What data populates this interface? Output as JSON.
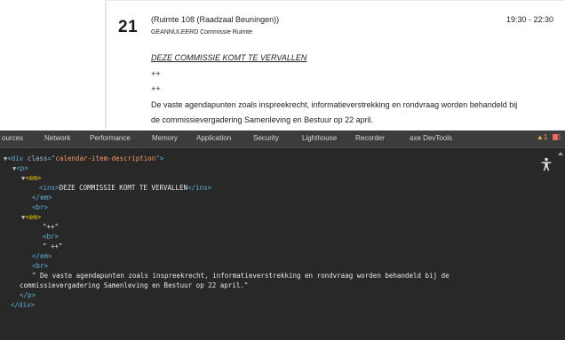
{
  "page": {
    "day": "21",
    "location": "(Ruimte 108 (Raadzaal Beuningen))",
    "status": "GEANNULEERD Commissie Ruimte",
    "time": "19:30 - 22:30",
    "cancel_notice": "DEZE COMMISSIE KOMT TE VERVALLEN",
    "plus1": "++",
    "plus2": "++",
    "body_line1": "De vaste agendapunten zoals inspreekrecht, informatieverstrekking en rondvraag worden behandeld bij",
    "body_line2": "de commissievergadering Samenleving en Bestuur op 22 april."
  },
  "devtools": {
    "tabs": [
      "ources",
      "Network",
      "Performance",
      "Memory",
      "Application",
      "Security",
      "Lighthouse",
      "Recorder",
      "axe DevTools"
    ],
    "warnings": "1",
    "errors": "1",
    "icons": {
      "accessibility": "accessibility-person-icon",
      "warning": "warning-triangle-icon",
      "error": "error-square-icon"
    },
    "dom": {
      "div_open_prefix": "<div ",
      "div_attr": "class",
      "div_eq": "=\"",
      "div_val": "calendar-item-description",
      "div_close_q": "\">",
      "p_open": "<p>",
      "em_open": "<em>",
      "ins_open": "<ins>",
      "ins_text": "DEZE COMMISSIE KOMT TE VERVALLEN",
      "ins_close": "</ins>",
      "em_close": "</em>",
      "br": "<br>",
      "plus_text1": "\"++\"",
      "plus_text2": "\" ++\"",
      "long_text1": "\" De vaste agendapunten zoals inspreekrecht, informatieverstrekking en rondvraag worden behandeld bij de",
      "long_text2": "commissievergadering Samenleving en Bestuur op 22 april.\"",
      "p_close": "</p>",
      "div_close": "</div>"
    }
  }
}
